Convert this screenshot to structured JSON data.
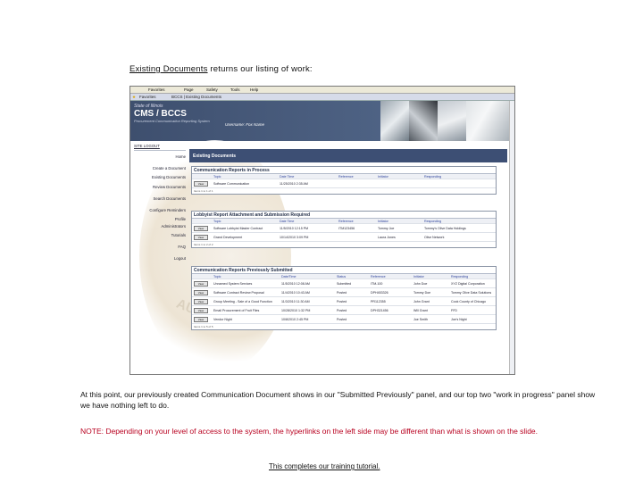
{
  "slide": {
    "intro_link": "Existing Documents",
    "intro_rest": " returns our listing of work:",
    "paragraph": "At this point, our previously created Communication Document shows in our \"Submitted Previously\" panel, and our top two \"work in progress\" panel show we have nothing left to do.",
    "note": "NOTE:  Depending on your level of access to the system, the hyperlinks on the left side may be different than what is shown on the slide.",
    "closing": "This completes our training tutorial."
  },
  "browser": {
    "menu": [
      "Favorites",
      "Page",
      "Safety",
      "Tools",
      "Help"
    ],
    "tab_left": "Favorites",
    "tab_title": "BCCS | Existing Documents"
  },
  "banner": {
    "state": "State of Illinois",
    "title": "CMS / BCCS",
    "subtitle": "Procurement Communication Reporting System",
    "user": "Username: Fox Name"
  },
  "colors": {
    "banner": "#3e4f6e",
    "heading": "#3d4f74",
    "note": "#b8001f",
    "link": "#2a3f9a"
  },
  "sidebar": {
    "site_link": "SITE LOGOUT",
    "items": [
      "Home",
      "Create a Document",
      "Existing Documents",
      "Review Documents",
      "Search Documents",
      "Configure Reminders",
      "Profile",
      "Administrators",
      "Tutorials",
      "FAQ",
      "Logout"
    ]
  },
  "main": {
    "heading": "Existing Documents",
    "button": "View",
    "panel1": {
      "title": "Communication Reports in Process",
      "headers": [
        "Topic",
        "Date Time",
        "Reference",
        "Initiator",
        "Responding"
      ],
      "rows": [
        [
          "Software Communication",
          "11/25/2010 2:35 AM",
          "",
          "",
          ""
        ]
      ],
      "footer": "Items 1 to 1 of 1"
    },
    "panel2": {
      "title": "Lobbyist Report Attachment and Submission Required",
      "headers": [
        "Topic",
        "Date Time",
        "Reference",
        "Initiator",
        "Responding"
      ],
      "rows": [
        [
          "Software Lobbyist Master Contract",
          "11/5/2010 12:15 PM",
          "ITM123456",
          "Tommy Joe",
          "Tommy's Olive Data Holdings"
        ],
        [
          "Grand Development",
          "10/14/2010 3:09 PM",
          "",
          "Laura Jones",
          "Olive Network"
        ]
      ],
      "footer": "Items 1 to 2 of 2"
    },
    "panel3": {
      "title": "Communication Reports Previously Submitted",
      "headers": [
        "Topic",
        "Date/Time",
        "Status",
        "Reference",
        "Initiator",
        "Responding"
      ],
      "rows": [
        [
          "Unnamed System Services",
          "11/5/2010 12:08 AM",
          "Submitted",
          "ITM-100",
          "John Doe",
          "XYZ Digital Corporation"
        ],
        [
          "Software Contract Review Proposal",
          "11/4/2010 10:43 AM",
          "Posted",
          "DPH453326",
          "Tommy Doe",
          "Tommy Olive Data Solutions"
        ],
        [
          "Group Meeting - Sale of a Good Function",
          "11/3/2010 11:30 AM",
          "Posted",
          "PR112355",
          "John Grant",
          "Cook County of Chicago"
        ],
        [
          "Email Procurement of Fruit Flies",
          "10/28/2010 1:32 PM",
          "Posted",
          "DPH321456",
          "Will Grant",
          "FFD"
        ],
        [
          "Vendor Night",
          "10/8/2010 2:45 PM",
          "Posted",
          "",
          "Joe Smith",
          "Joe's Night"
        ]
      ],
      "footer": "Items 1 to 5 of 5"
    }
  }
}
